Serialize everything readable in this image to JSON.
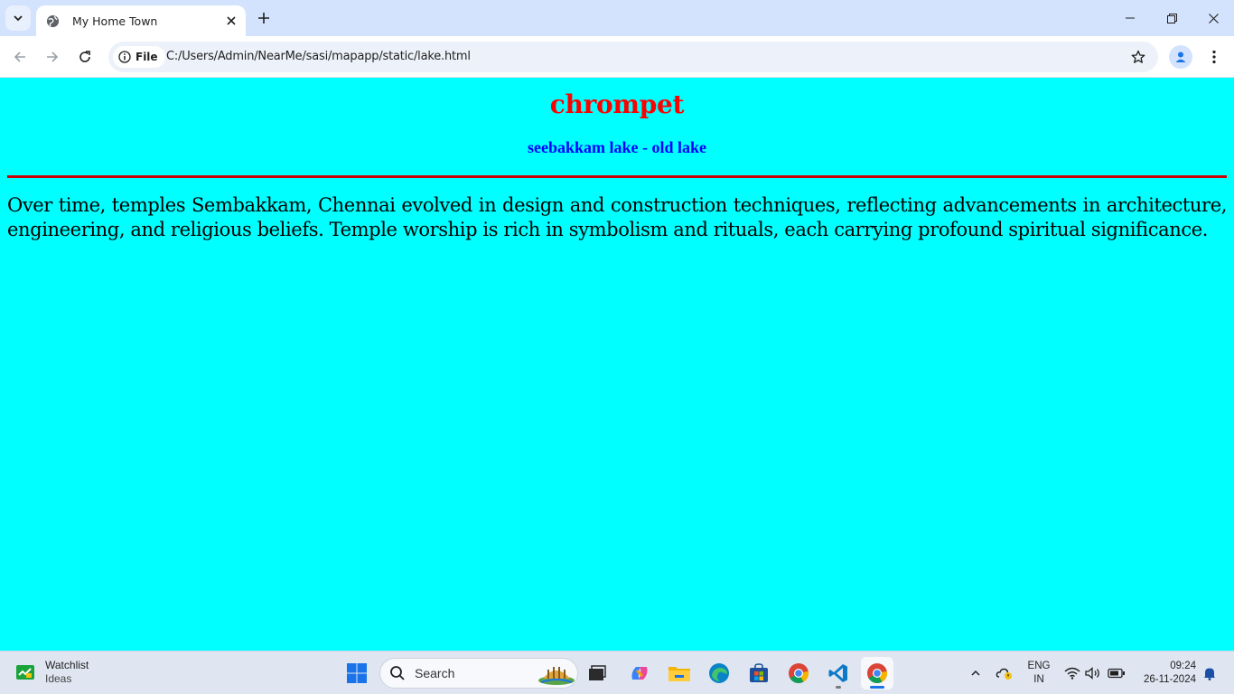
{
  "browser": {
    "tab": {
      "title": "My Home Town"
    },
    "address_bar": {
      "site_chip_label": "File",
      "url": "C:/Users/Admin/NearMe/sasi/mapapp/static/lake.html"
    }
  },
  "page": {
    "heading": "chrompet",
    "subheading": "seebakkam lake - old lake",
    "paragraph": "Over time, temples Sembakkam, Chennai evolved in design and construction techniques, reflecting advancements in architecture, engineering, and religious beliefs. Temple worship is rich in symbolism and rituals, each carrying profound spiritual significance.",
    "colors": {
      "background": "#00ffff",
      "heading": "#ff0000",
      "subheading": "#0000ff",
      "rule": "#cc0000",
      "text": "#000000"
    }
  },
  "taskbar": {
    "widget": {
      "title": "Watchlist",
      "subtitle": "Ideas"
    },
    "search_placeholder": "Search",
    "apps": [
      "start-icon",
      "search-icon",
      "task-view-icon",
      "copilot-icon",
      "file-explorer-icon",
      "edge-icon",
      "microsoft-store-icon",
      "chrome-icon",
      "vscode-icon",
      "chrome-icon"
    ],
    "tray": {
      "language_line1": "ENG",
      "language_line2": "IN",
      "time": "09:24",
      "date": "26-11-2024"
    }
  }
}
